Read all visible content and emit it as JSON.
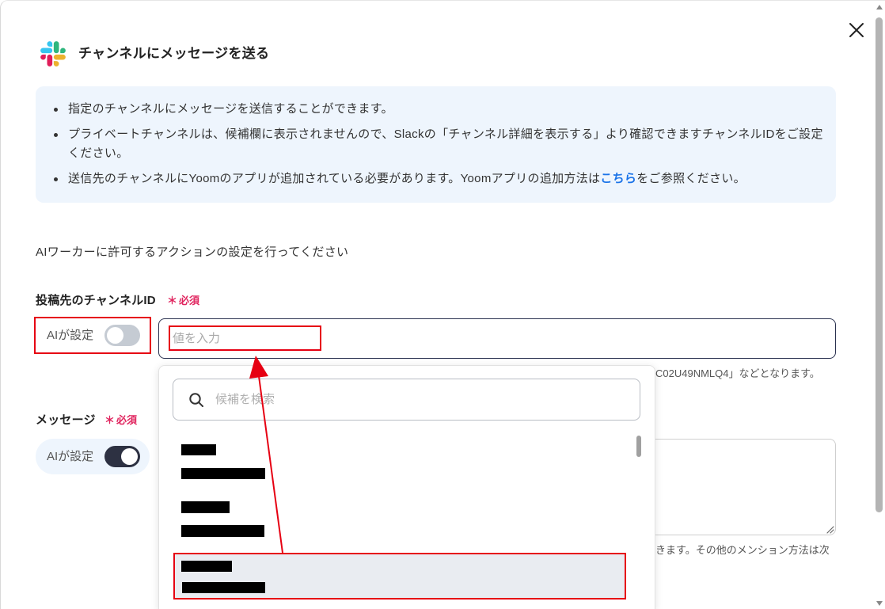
{
  "dialog": {
    "title": "チャンネルにメッセージを送る",
    "app_icon": "slack-logo-icon",
    "close_icon": "close-icon"
  },
  "info": {
    "bullet_1": "指定のチャンネルにメッセージを送信することができます。",
    "bullet_2": "プライベートチャンネルは、候補欄に表示されませんので、Slackの「チャンネル詳細を表示する」より確認できますチャンネルIDをご設定ください。",
    "bullet_3_before": "送信先のチャンネルにYoomのアプリが追加されている必要があります。Yoomアプリの追加方法は",
    "bullet_3_link": "こちら",
    "bullet_3_after": "をご参照ください。"
  },
  "intro": "AIワーカーに許可するアクションの設定を行ってください",
  "channel_field": {
    "label": "投稿先のチャンネルID",
    "required_mark": "＊",
    "required_label": "必須",
    "ai_toggle_label": "AIが設定",
    "ai_toggle_on": false,
    "placeholder": "値を入力",
    "helper_text": "C02U49NMLQ4」などとなります。"
  },
  "message_field": {
    "label": "メッセージ",
    "required_mark": "＊",
    "required_label": "必須",
    "ai_toggle_label": "AIが設定",
    "ai_toggle_on": true,
    "helper_text": "きます。その他のメンション方法は次"
  },
  "dropdown": {
    "search_placeholder": "候補を検索",
    "search_icon": "search-icon"
  },
  "colors": {
    "accent": "#2B3250",
    "info_bg": "#EEF5FD",
    "link": "#1A73E8",
    "required": "#E0245E",
    "toggle_on": "#2D3142",
    "toggle_off": "#C5CBD3",
    "option_hover": "#E9ECF1",
    "annotation": "#E60012"
  }
}
